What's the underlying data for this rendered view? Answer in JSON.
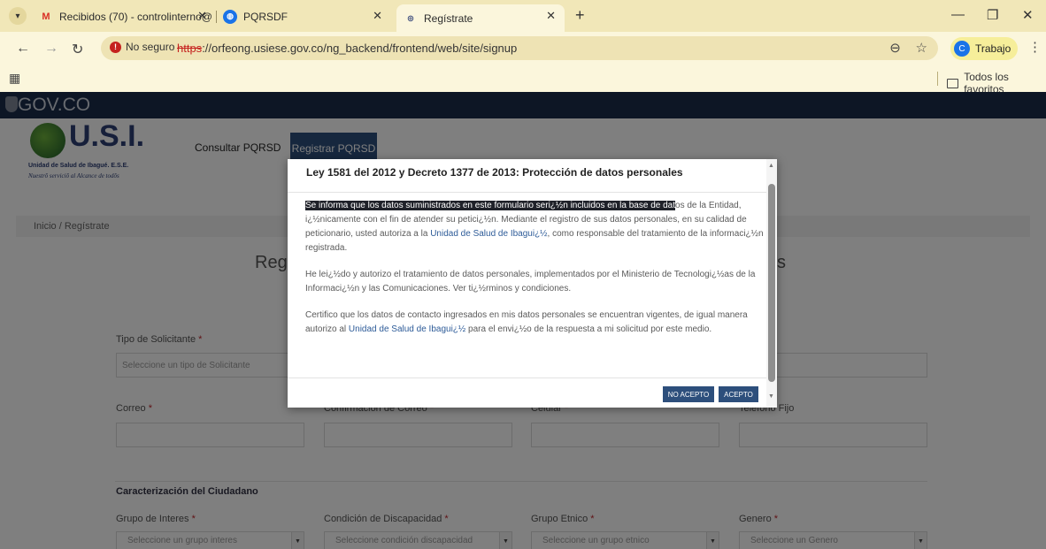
{
  "browser": {
    "tabs": [
      {
        "title": "Recibidos (70) - controlinterno@",
        "favicon": "M"
      },
      {
        "title": "PQRSDF",
        "favicon": "globe"
      },
      {
        "title": "Regístrate",
        "favicon": "usi"
      }
    ],
    "security_label": "No seguro",
    "url_protocol": "https",
    "url_rest": "://orfeong.usiese.gov.co/ng_backend/frontend/web/site/signup",
    "profile_initial": "C",
    "profile_name": "Trabajo",
    "bookmarks_all": "Todos los favoritos"
  },
  "site": {
    "gov_label": "GOV.CO",
    "logo_text": "U.S.I.",
    "logo_subtitle": "Unidad de Salud de Ibagué. E.S.E.",
    "logo_slogan": "Nuestrõ serviciõ al Alcance de todõs",
    "nav": {
      "consultar": "Consultar PQRSD",
      "registrar": "Registrar PQRSD"
    },
    "breadcrumb": "Inicio / Regístrate",
    "heading_left": "Regi",
    "heading_right": "s",
    "fields": {
      "tipo_label": "Tipo de Solicitante",
      "tipo_placeholder": "Seleccione un tipo de Solicitante",
      "correo_label": "Correo",
      "confirm_label": "Confirmación de Correo",
      "celular_label": "Celular",
      "telefono_label": "Telefono Fijo"
    },
    "section_title": "Caracterización del Ciudadano",
    "selects": [
      {
        "label": "Grupo de Interes",
        "placeholder": "Seleccione un grupo interes"
      },
      {
        "label": "Condición de Discapacidad",
        "placeholder": "Seleccione condición discapacidad"
      },
      {
        "label": "Grupo Etnico",
        "placeholder": "Seleccione un grupo etnico"
      },
      {
        "label": "Genero",
        "placeholder": "Seleccione un Genero"
      }
    ],
    "required_mark": "*"
  },
  "modal": {
    "title": "Ley 1581 del 2012 y Decreto 1377 de 2013: Protección de datos personales",
    "p1_highlight": "Se informa que los datos suministrados en este formulario seri¿½n incluidos en la base de dat",
    "p1_rest": "os de la Entidad, i¿½nicamente con el fin de atender su petici¿½n. Mediante el registro de sus datos personales, en su calidad de peticionario, usted autoriza a la ",
    "p1_link": "Unidad de Salud de Ibagui¿½",
    "p1_end": ", como responsable del tratamiento de la informaci¿½n registrada.",
    "p2": "He lei¿½do y autorizo el tratamiento de datos personales, implementados por el Ministerio de Tecnologi¿½as de la Informaci¿½n y las Comunicaciones. Ver ti¿½rminos y condiciones.",
    "p3_start": "Certifico que los datos de contacto ingresados en mis datos personales se encuentran vigentes, de igual manera autorizo al ",
    "p3_link": "Unidad de Salud de Ibagui¿½",
    "p3_end": " para el envi¿½o de la respuesta a mi solicitud por este medio.",
    "btn_reject": "NO ACEPTO",
    "btn_accept": "ACEPTO"
  }
}
